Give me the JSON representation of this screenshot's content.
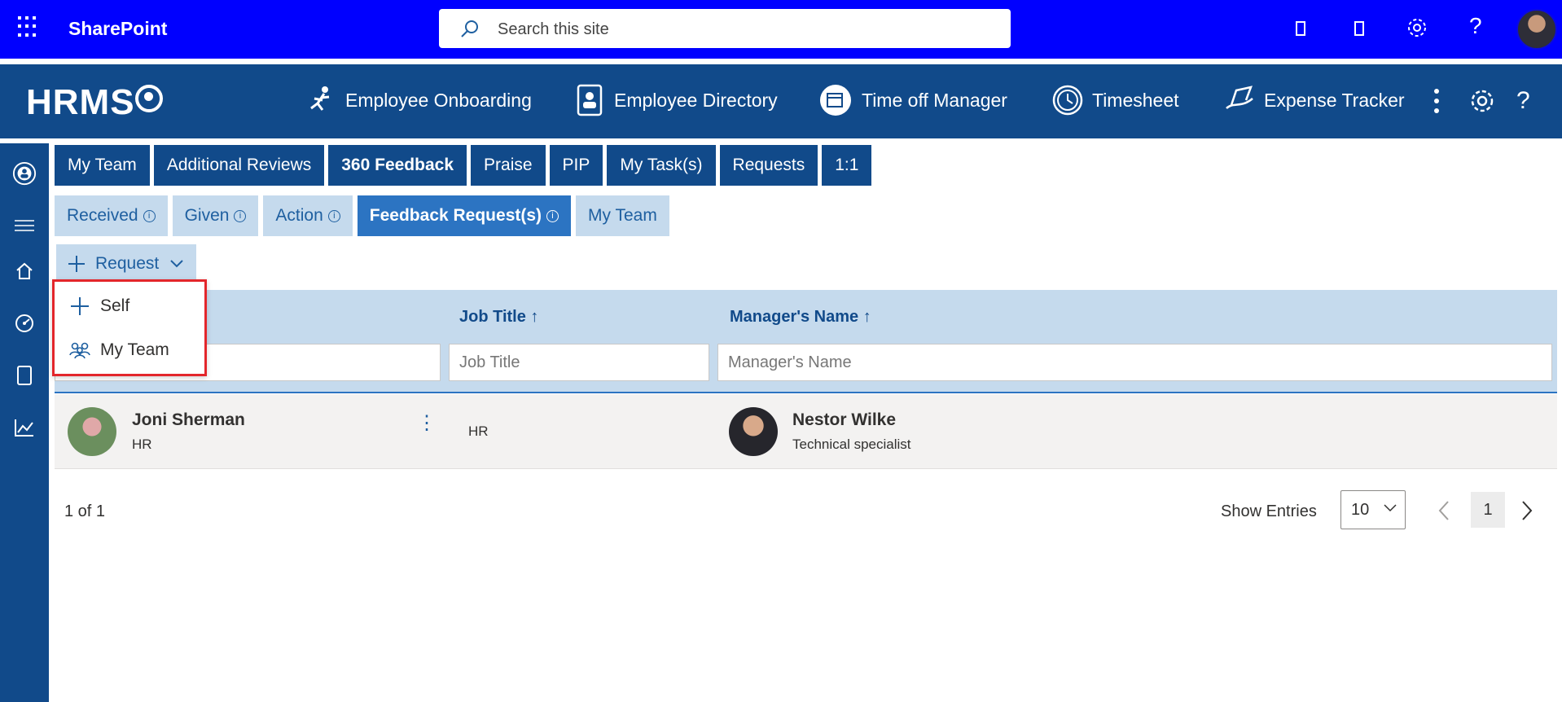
{
  "suite": {
    "title": "SharePoint",
    "search_placeholder": "Search this site"
  },
  "app": {
    "logo": "HRMS",
    "nav": [
      {
        "label": "Employee Onboarding",
        "icon": "onboarding-icon"
      },
      {
        "label": "Employee Directory",
        "icon": "directory-icon"
      },
      {
        "label": "Time off Manager",
        "icon": "calendar-icon"
      },
      {
        "label": "Timesheet",
        "icon": "clock-icon"
      },
      {
        "label": "Expense Tracker",
        "icon": "expense-icon"
      }
    ]
  },
  "rail": [
    "user-circle-icon",
    "hamburger-icon",
    "home-icon",
    "dashboard-icon",
    "document-icon",
    "chart-icon"
  ],
  "tabs": [
    "My Team",
    "Additional Reviews",
    "360 Feedback",
    "Praise",
    "PIP",
    "My Task(s)",
    "Requests",
    "1:1"
  ],
  "active_tab": "360 Feedback",
  "subtabs": [
    "Received",
    "Given",
    "Action",
    "Feedback Request(s)",
    "My Team"
  ],
  "active_subtab": "Feedback Request(s)",
  "request_button": {
    "label": "Request"
  },
  "menu": {
    "items": [
      {
        "label": "Self",
        "icon": "plus-icon"
      },
      {
        "label": "My Team",
        "icon": "people-icon"
      }
    ]
  },
  "table": {
    "columns": [
      "Job Title ↑",
      "Manager's Name ↑"
    ],
    "filters": [
      "Job Title",
      "Manager's Name"
    ],
    "rows": [
      {
        "name": "Joni Sherman",
        "department": "HR",
        "job_title": "HR",
        "manager_name": "Nestor Wilke",
        "manager_title": "Technical specialist"
      }
    ]
  },
  "pagination": {
    "count": "1 of 1",
    "show_entries_label": "Show Entries",
    "entries": "10",
    "page": "1"
  },
  "colors": {
    "suite_bar": "#0000ff",
    "brand": "#114a8a",
    "accent": "#2c74c2",
    "light": "#c5daed",
    "highlight": "#e3262b"
  }
}
